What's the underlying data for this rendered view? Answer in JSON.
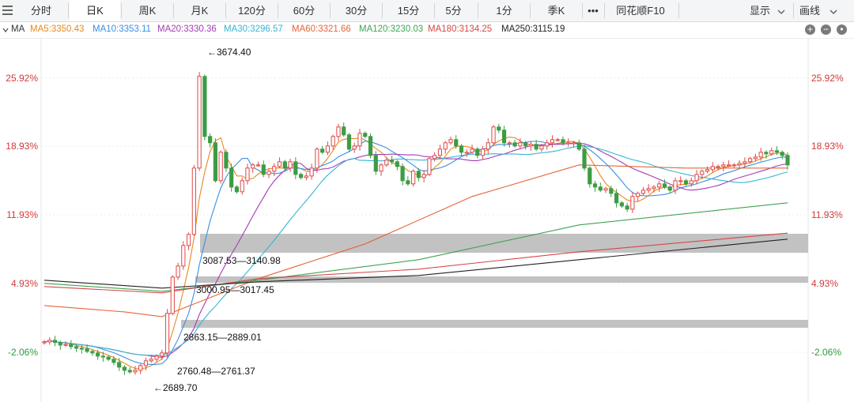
{
  "toolbar": {
    "tabs": [
      "分时",
      "日K",
      "周K",
      "月K",
      "120分",
      "60分",
      "30分",
      "15分",
      "5分",
      "1分",
      "季K",
      "•••",
      "同花顺F10"
    ],
    "active_tab": "日K",
    "display_label": "显示",
    "draw_label": "画线"
  },
  "ma_legend": {
    "title": "MA",
    "items": [
      {
        "label": "MA5:3350.43",
        "color": "#e8891c"
      },
      {
        "label": "MA10:3353.11",
        "color": "#3b8fe0"
      },
      {
        "label": "MA20:3330.36",
        "color": "#a43cb4"
      },
      {
        "label": "MA30:3296.57",
        "color": "#35b6d2"
      },
      {
        "label": "MA60:3321.66",
        "color": "#e4663b"
      },
      {
        "label": "MA120:3230.03",
        "color": "#3ea452"
      },
      {
        "label": "MA180:3134.25",
        "color": "#d64848"
      },
      {
        "label": "MA250:3115.19",
        "color": "#222222"
      }
    ]
  },
  "axis": {
    "left_labels": [
      "25.92%",
      "18.93%",
      "11.93%",
      "4.93%",
      "-2.06%"
    ],
    "right_labels": [
      "25.92%",
      "18.93%",
      "11.93%",
      "4.93%",
      "-2.06%"
    ],
    "positive_color": "#d03a3a",
    "negative_color": "#2c9b3c"
  },
  "annotations": {
    "high": "3674.40",
    "low": "2689.70",
    "gap1": "3087.53—3140.98",
    "gap2": "3000.95—3017.45",
    "gap3": "2863.15—2889.01",
    "gap4": "2760.48—2761.37"
  },
  "chart_data": {
    "type": "candlestick",
    "title": "",
    "y_axis_unit": "percent change",
    "y_ticks": [
      25.92,
      18.93,
      11.93,
      4.93,
      -2.06
    ],
    "price_high": 3674.4,
    "price_low": 2689.7,
    "gap_zones": [
      "3087.53—3140.98",
      "3000.95—3017.45",
      "2863.15—2889.01",
      "2760.48—2761.37"
    ],
    "series": [
      {
        "name": "MA5",
        "last": 3350.43
      },
      {
        "name": "MA10",
        "last": 3353.11
      },
      {
        "name": "MA20",
        "last": 3330.36
      },
      {
        "name": "MA30",
        "last": 3296.57
      },
      {
        "name": "MA60",
        "last": 3321.66
      },
      {
        "name": "MA120",
        "last": 3230.03
      },
      {
        "name": "MA180",
        "last": 3134.25
      },
      {
        "name": "MA250",
        "last": 3115.19
      }
    ],
    "candles_close": [
      2790,
      2795,
      2788,
      2780,
      2782,
      2775,
      2770,
      2768,
      2760,
      2755,
      2745,
      2742,
      2735,
      2725,
      2710,
      2700,
      2695,
      2700,
      2715,
      2730,
      2735,
      2745,
      2755,
      2880,
      2995,
      3030,
      3095,
      3130,
      3340,
      3630,
      3440,
      3420,
      3300,
      3390,
      3340,
      3280,
      3265,
      3300,
      3340,
      3350,
      3350,
      3320,
      3330,
      3345,
      3360,
      3340,
      3360,
      3320,
      3310,
      3315,
      3340,
      3400,
      3390,
      3410,
      3440,
      3470,
      3445,
      3400,
      3410,
      3450,
      3440,
      3380,
      3330,
      3350,
      3365,
      3360,
      3345,
      3300,
      3290,
      3330,
      3310,
      3320,
      3370,
      3380,
      3400,
      3420,
      3430,
      3410,
      3390,
      3390,
      3400,
      3380,
      3400,
      3420,
      3470,
      3460,
      3420,
      3420,
      3410,
      3420,
      3410,
      3415,
      3400,
      3410,
      3420,
      3430,
      3430,
      3420,
      3420,
      3420,
      3400,
      3340,
      3290,
      3280,
      3270,
      3275,
      3260,
      3230,
      3220,
      3210,
      3250,
      3260,
      3270,
      3275,
      3280,
      3290,
      3280,
      3270,
      3300,
      3300,
      3290,
      3300,
      3320,
      3330,
      3335,
      3345,
      3345,
      3350,
      3350,
      3350,
      3355,
      3360,
      3370,
      3375,
      3390,
      3385,
      3395,
      3390,
      3380,
      3350
    ]
  }
}
